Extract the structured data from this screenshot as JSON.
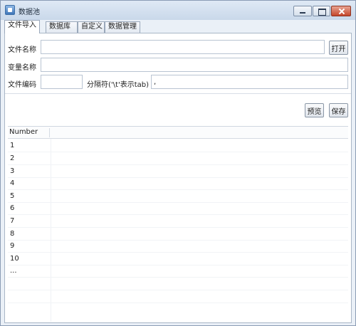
{
  "window": {
    "title": "数据池",
    "icon": "app-icon"
  },
  "tabs": [
    {
      "label": "文件导入",
      "active": true
    },
    {
      "label": "数据库",
      "active": false
    },
    {
      "label": "自定义",
      "active": false
    },
    {
      "label": "数据管理",
      "active": false
    }
  ],
  "form": {
    "file_name_label": "文件名称",
    "file_name_value": "",
    "open_button": "打开",
    "var_name_label": "变量名称",
    "var_name_value": "",
    "encoding_label": "文件编码",
    "encoding_value": "",
    "separator_label": "分隔符('\\t'表示tab)",
    "separator_value": ","
  },
  "actions": {
    "preview_button": "预览",
    "save_button": "保存"
  },
  "table": {
    "column_header": "Number",
    "rows": [
      "1",
      "2",
      "3",
      "4",
      "5",
      "6",
      "7",
      "8",
      "9",
      "10",
      "..."
    ]
  }
}
